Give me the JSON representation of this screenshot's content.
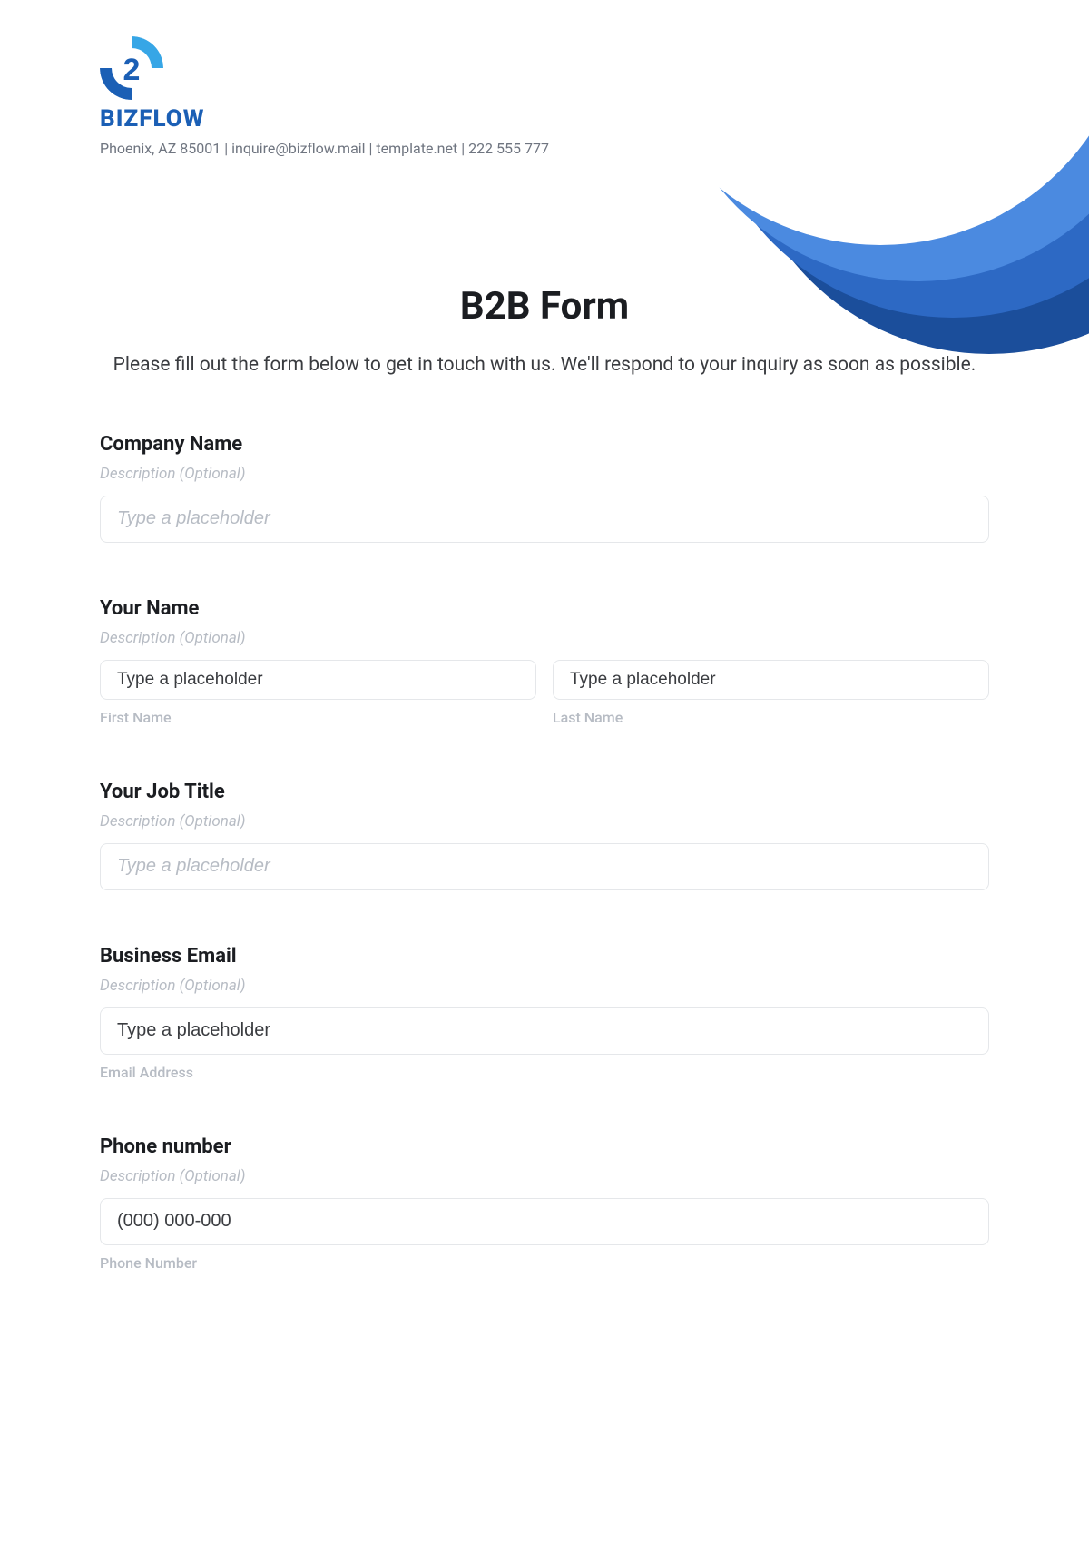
{
  "brand": {
    "name": "BIZFLOW",
    "contact_line": "Phoenix, AZ 85001 | inquire@bizflow.mail | template.net | 222 555 777"
  },
  "form": {
    "title": "B2B Form",
    "intro": "Please fill out the form below to get in touch with us. We'll respond to your inquiry as soon as possible.",
    "desc_placeholder": "Description (Optional)",
    "fields": {
      "company": {
        "label": "Company Name",
        "placeholder": "Type a placeholder"
      },
      "name": {
        "label": "Your Name",
        "first_placeholder": "Type a placeholder",
        "last_placeholder": "Type a placeholder",
        "first_sub": "First Name",
        "last_sub": "Last Name"
      },
      "job": {
        "label": "Your Job Title",
        "placeholder": "Type a placeholder"
      },
      "email": {
        "label": "Business Email",
        "placeholder": "Type a placeholder",
        "sub": "Email Address"
      },
      "phone": {
        "label": "Phone number",
        "placeholder": "(000) 000-000",
        "sub": "Phone Number"
      }
    }
  }
}
